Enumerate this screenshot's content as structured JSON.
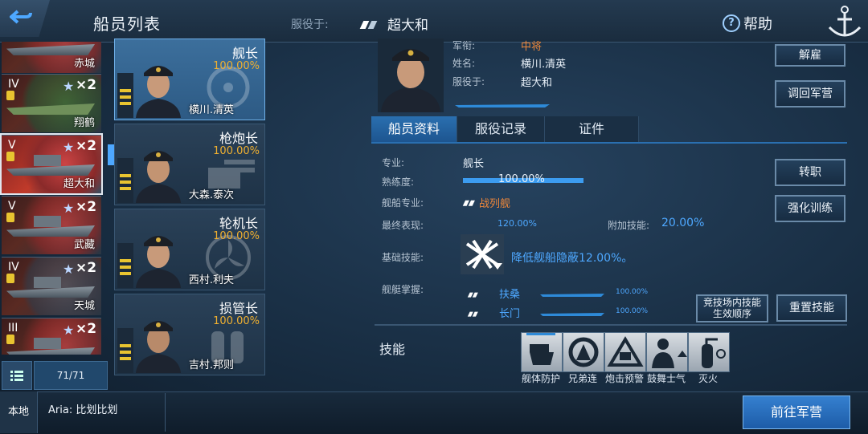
{
  "header": {
    "title": "船员列表",
    "serve_label": "服役于:",
    "serve_ship": "超大和",
    "help": "帮助"
  },
  "ships": [
    {
      "tier": "",
      "mult": "",
      "name": "赤城"
    },
    {
      "tier": "IV",
      "mult": "×2",
      "name": "翔鹤"
    },
    {
      "tier": "V",
      "mult": "×2",
      "name": "超大和"
    },
    {
      "tier": "V",
      "mult": "×2",
      "name": "武藏"
    },
    {
      "tier": "IV",
      "mult": "×2",
      "name": "天城"
    },
    {
      "tier": "III",
      "mult": "×2",
      "name": ""
    }
  ],
  "list_count": "71/71",
  "crew": [
    {
      "role": "舰长",
      "pct": "100.00%",
      "name": "横川.清英"
    },
    {
      "role": "枪炮长",
      "pct": "100.00%",
      "name": "大森.泰次"
    },
    {
      "role": "轮机长",
      "pct": "100.00%",
      "name": "西村.利夫"
    },
    {
      "role": "损管长",
      "pct": "100.00%",
      "name": "吉村.邦则"
    }
  ],
  "profile": {
    "rank_label": "军衔:",
    "rank": "中将",
    "name_label": "姓名:",
    "name": "横川.清英",
    "serve_label": "服役于:",
    "serve": "超大和"
  },
  "buttons": {
    "dismiss": "解雇",
    "return": "调回军营",
    "transfer": "转职",
    "train": "强化训练",
    "order_line1": "竞技场内技能",
    "order_line2": "生效顺序",
    "reset": "重置技能",
    "goto": "前往军营",
    "local": "本地"
  },
  "tabs": [
    "船员资料",
    "服役记录",
    "证件"
  ],
  "info": {
    "spec_label": "专业:",
    "spec": "舰长",
    "prof_label": "熟练度:",
    "prof": "100.00%",
    "prof_value": 1.0,
    "shipspec_label": "舰船专业:",
    "shipspec": "战列舰",
    "final_label": "最终表现:",
    "final": "120.00%",
    "extra_label": "附加技能:",
    "extra": "20.00%",
    "base_label": "基础技能:",
    "base": "降低舰船隐蔽12.00%。",
    "mastery_label": "舰艇掌握:",
    "mastery": [
      {
        "ship": "扶桑",
        "pct": "100.00%"
      },
      {
        "ship": "长门",
        "pct": "100.00%"
      }
    ],
    "skills_label": "技能"
  },
  "skills": [
    {
      "label": "舰体防护",
      "icon": "hull-protection-icon"
    },
    {
      "label": "兄弟连",
      "icon": "brotherhood-icon"
    },
    {
      "label": "炮击预警",
      "icon": "gun-warning-icon"
    },
    {
      "label": "鼓舞士气",
      "icon": "morale-icon"
    },
    {
      "label": "灭火",
      "icon": "extinguisher-icon"
    }
  ],
  "chat": "Aria: 比划比划"
}
